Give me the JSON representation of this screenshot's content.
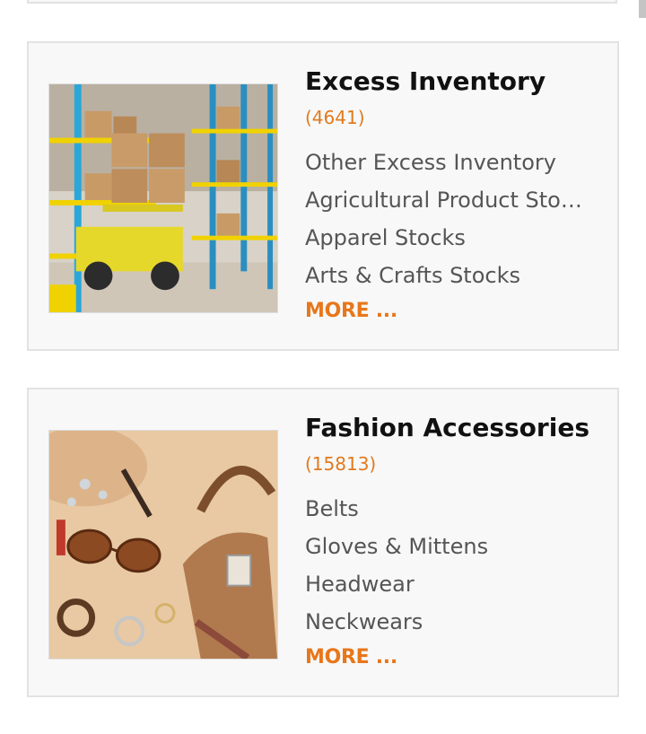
{
  "categories": [
    {
      "title": "Excess Inventory",
      "count": "(4641)",
      "image": "warehouse-forklift-image",
      "subcategories": [
        "Other Excess Inventory",
        "Agricultural Product Sto…",
        "Apparel Stocks",
        "Arts & Crafts Stocks"
      ],
      "more_label": "MORE ..."
    },
    {
      "title": "Fashion Accessories",
      "count": "(15813)",
      "image": "accessories-handbag-sunglasses-image",
      "subcategories": [
        "Belts",
        "Gloves & Mittens",
        "Headwear",
        "Neckwears"
      ],
      "more_label": "MORE ..."
    }
  ],
  "colors": {
    "accent": "#e8771b",
    "count": "#e07a1f",
    "title": "#111111",
    "subitem": "#555555",
    "card_bg": "#f8f8f8",
    "card_border": "#e2e2e2"
  }
}
